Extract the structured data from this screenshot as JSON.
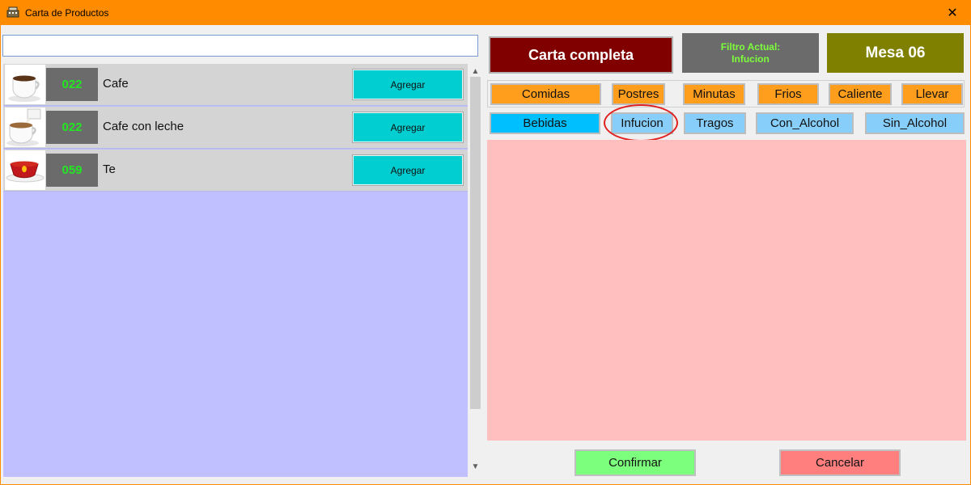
{
  "window": {
    "title": "Carta de Productos",
    "close_glyph": "✕",
    "title_bar_color": "#ff8c00",
    "app_icon": "cash-register-icon"
  },
  "search": {
    "value": "",
    "placeholder": ""
  },
  "products": [
    {
      "icon": "coffee-cup-icon",
      "code": "022",
      "name": "Cafe",
      "button": "Agregar"
    },
    {
      "icon": "coffee-with-milk-icon",
      "code": "022",
      "name": "Cafe con leche",
      "button": "Agregar"
    },
    {
      "icon": "tea-cup-icon",
      "code": "059",
      "name": "Te",
      "button": "Agregar"
    }
  ],
  "header": {
    "carta_label": "Carta completa",
    "filtro_label": "Filtro Actual:",
    "filtro_value": "Infucion",
    "mesa_label": "Mesa 06"
  },
  "categories_row1": [
    "Comidas",
    "Postres",
    "Minutas",
    "Frios",
    "Caliente",
    "Llevar"
  ],
  "categories_row2": [
    "Bebidas",
    "Infucion",
    "Tragos",
    "Con_Alcohol",
    "Sin_Alcohol"
  ],
  "selected_category": "Infucion",
  "footer": {
    "confirm_label": "Confirmar",
    "cancel_label": "Cancelar"
  },
  "colors": {
    "list_background": "#c0bfff",
    "detail_background": "#ffbfbf",
    "carta_button": "#800000",
    "filtro_box": "#6b6b6b",
    "mesa_box": "#808000",
    "add_button": "#00ced1",
    "code_text": "#22e622",
    "confirm_button": "#7cff7c",
    "cancel_button": "#ff7f7f",
    "highlight": "#e02020"
  }
}
